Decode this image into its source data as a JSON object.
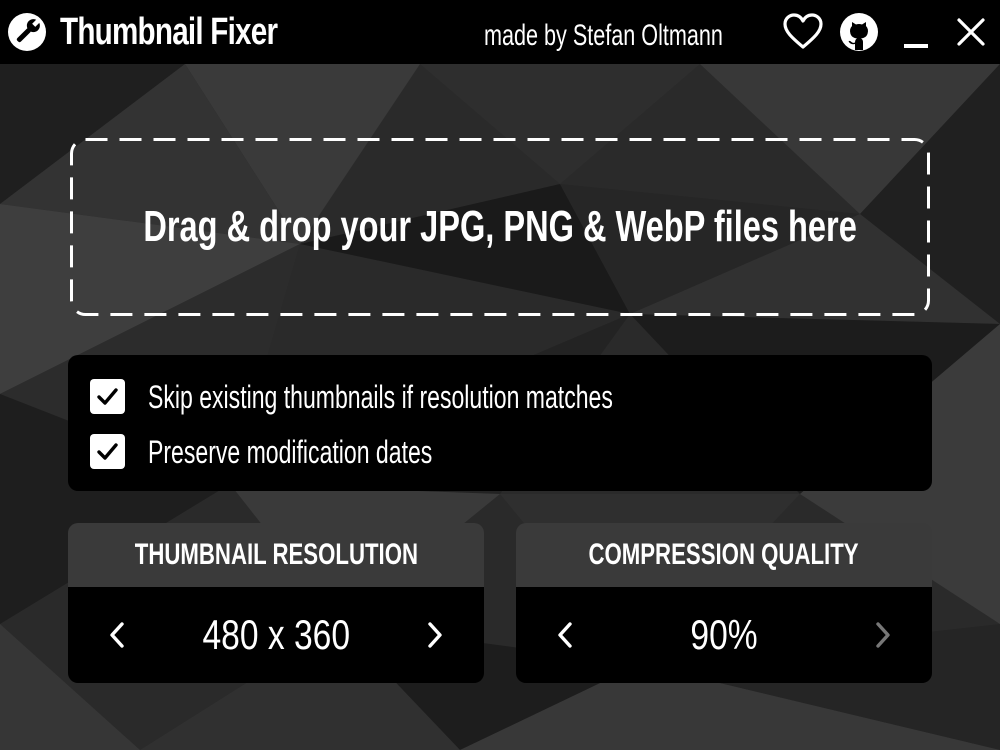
{
  "app": {
    "title": "Thumbnail Fixer",
    "author": "made by Stefan Oltmann",
    "icons": [
      "wrench-icon",
      "heart-icon",
      "github-icon",
      "minimize-icon",
      "close-icon"
    ]
  },
  "dropzone": {
    "text": "Drag & drop your JPG, PNG & WebP files here"
  },
  "options": [
    {
      "label": "Skip existing thumbnails if resolution matches",
      "checked": true
    },
    {
      "label": "Preserve modification dates",
      "checked": true
    }
  ],
  "resolution": {
    "title": "THUMBNAIL RESOLUTION",
    "value": "480 x 360"
  },
  "quality": {
    "title": "COMPRESSION QUALITY",
    "value": "90%"
  },
  "colors": {
    "background": "#000000",
    "panel_header": "#3a3a3a",
    "text": "#ffffff",
    "disabled_arrow": "#777777"
  }
}
